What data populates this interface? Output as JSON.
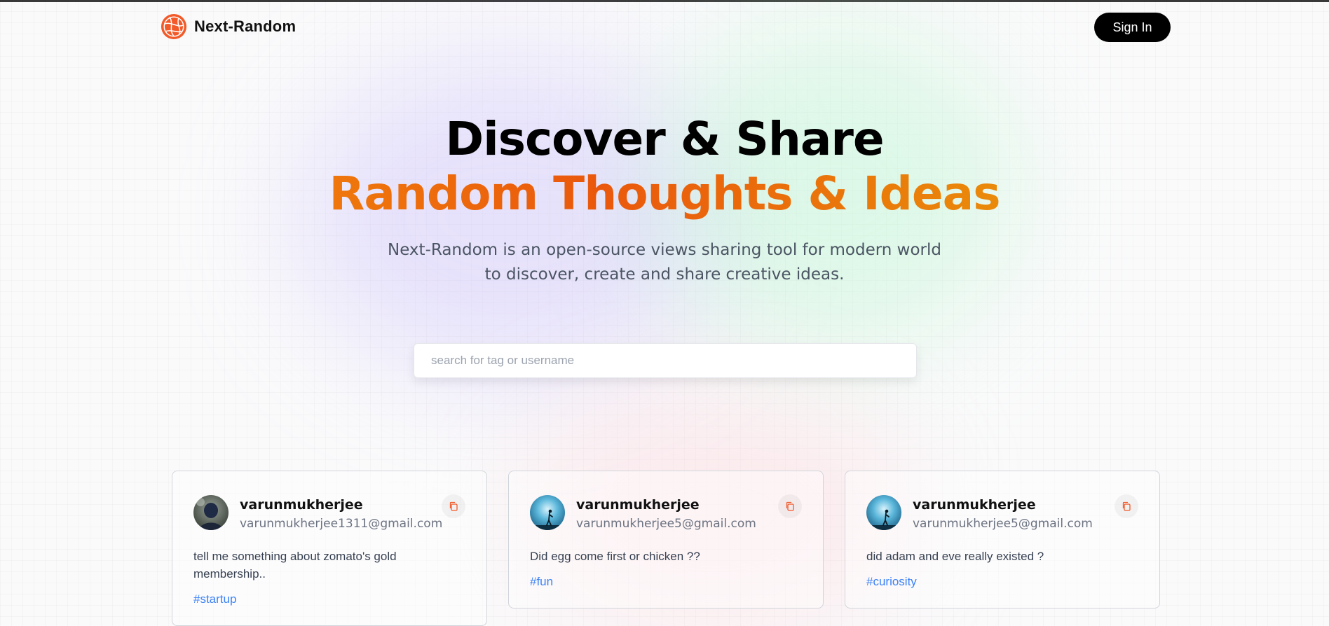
{
  "app": {
    "name": "Next-Random"
  },
  "nav": {
    "signin_label": "Sign In"
  },
  "hero": {
    "title_line1": "Discover & Share",
    "title_line2": "Random Thoughts & Ideas",
    "subtitle": "Next-Random is an open-source views sharing tool for modern world to discover, create and share creative ideas."
  },
  "search": {
    "placeholder": "search for tag or username",
    "value": ""
  },
  "posts": [
    {
      "username": "varunmukherjee",
      "email": "varunmukherjee1311@gmail.com",
      "prompt": "tell me something about zomato's gold membership..",
      "tag": "#startup",
      "avatar": "avatar-photo-person"
    },
    {
      "username": "varunmukherjee",
      "email": "varunmukherjee5@gmail.com",
      "prompt": "Did egg come first or chicken ??",
      "tag": "#fun",
      "avatar": "avatar-photo-silhouette"
    },
    {
      "username": "varunmukherjee",
      "email": "varunmukherjee5@gmail.com",
      "prompt": "did adam and eve really existed ?",
      "tag": "#curiosity",
      "avatar": "avatar-photo-silhouette"
    }
  ],
  "icons": {
    "logo": "globe-logo-icon",
    "copy": "copy-icon"
  },
  "colors": {
    "accent_orange": "#ea580c",
    "tag_blue": "#3b82f6",
    "button_black": "#000000"
  }
}
